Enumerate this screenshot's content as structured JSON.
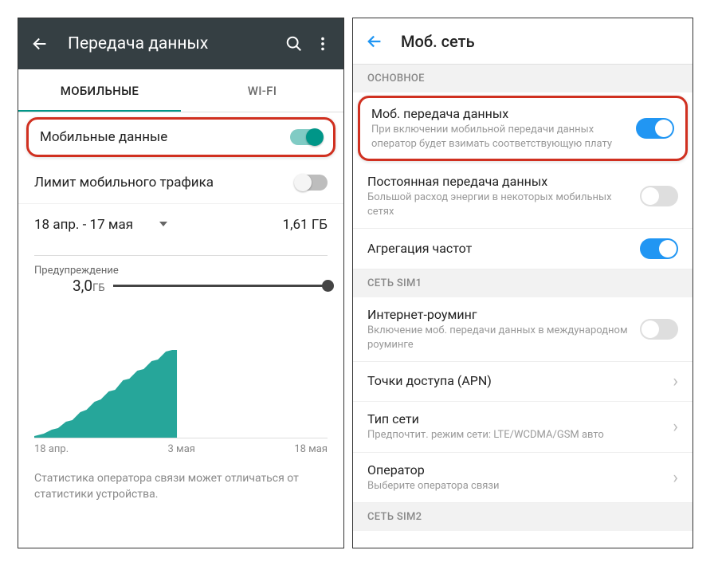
{
  "left": {
    "header": {
      "title": "Передача данных"
    },
    "tabs": {
      "mobile": "МОБИЛЬНЫЕ",
      "wifi": "WI-FI"
    },
    "mobile_data": {
      "label": "Мобильные данные",
      "on": true
    },
    "limit": {
      "label": "Лимит мобильного трафика",
      "on": false
    },
    "range": {
      "period": "18 апр. - 17 мая",
      "usage": "1,61 ГБ"
    },
    "chart": {
      "warning_label": "Предупреждение",
      "warning_value": "3,0",
      "warning_unit": "ГБ",
      "x_labels": {
        "start": "18 апр.",
        "mid": "3 мая",
        "end": "18 мая"
      }
    },
    "footer": "Статистика оператора связи может отличаться от статистики устройства."
  },
  "right": {
    "header": {
      "title": "Моб. сеть"
    },
    "section1": "ОСНОВНОЕ",
    "mobile_data": {
      "title": "Моб. передача данных",
      "subtitle": "При включении мобильной передачи данных оператор будет взимать соответствующую плату",
      "on": true
    },
    "always_on": {
      "title": "Постоянная передача данных",
      "subtitle": "Большой расход энергии в некоторых мобильных сетях",
      "on": false
    },
    "aggregation": {
      "title": "Агрегация частот",
      "on": true
    },
    "section2": "СЕТЬ SIM1",
    "roaming": {
      "title": "Интернет-роуминг",
      "subtitle": "Включение моб. передачи данных в международном роуминге",
      "on": false
    },
    "apn": {
      "title": "Точки доступа (APN)"
    },
    "network_type": {
      "title": "Тип сети",
      "subtitle": "Предпочтит. режим сети: LTE/WCDMA/GSM авто"
    },
    "operator": {
      "title": "Оператор",
      "subtitle": "Выберите оператора связи"
    },
    "section3": "СЕТЬ SIM2"
  },
  "chart_data": {
    "type": "area",
    "title": "",
    "xlabel": "",
    "ylabel": "ГБ",
    "x_range": [
      "18 апр.",
      "17 мая"
    ],
    "warning_threshold": 3.0,
    "total_usage": 1.61,
    "series": [
      {
        "name": "Мобильные данные",
        "x": [
          "18 апр.",
          "20 апр.",
          "22 апр.",
          "24 апр.",
          "26 апр.",
          "28 апр.",
          "30 апр.",
          "1 мая",
          "3 мая"
        ],
        "values": [
          0.0,
          0.1,
          0.25,
          0.45,
          0.7,
          0.95,
          1.2,
          1.45,
          1.61
        ]
      }
    ]
  }
}
